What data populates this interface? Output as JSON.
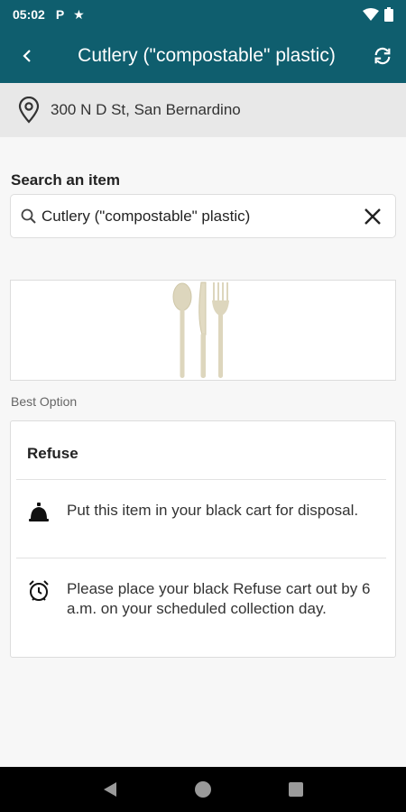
{
  "status_bar": {
    "time": "05:02",
    "icons": [
      "parking-icon",
      "star-icon",
      "wifi-icon",
      "battery-icon"
    ]
  },
  "app_bar": {
    "title": "Cutlery (\"compostable\" plastic)",
    "back_icon": "chevron-left-icon",
    "refresh_icon": "refresh-icon"
  },
  "location": {
    "address": "300 N D St, San Bernardino",
    "icon": "location-pin-icon"
  },
  "search": {
    "label": "Search an item",
    "value": "Cutlery (\"compostable\" plastic)",
    "search_icon": "search-icon",
    "clear_icon": "close-icon"
  },
  "item_image": {
    "icon": "cutlery-image"
  },
  "best_option": {
    "label": "Best Option",
    "title": "Refuse",
    "rows": [
      {
        "icon": "bell-icon",
        "text": "Put this item in your black cart for disposal."
      },
      {
        "icon": "alarm-clock-icon",
        "text": "Please place your black Refuse cart out by 6 a.m. on your scheduled collection day."
      }
    ]
  },
  "nav_bar": {
    "icons": [
      "back-triangle-icon",
      "home-circle-icon",
      "recents-square-icon"
    ]
  },
  "colors": {
    "app_bar": "#0f5e6e",
    "address_bg": "#e8e8e8",
    "page_bg": "#f7f7f7"
  }
}
